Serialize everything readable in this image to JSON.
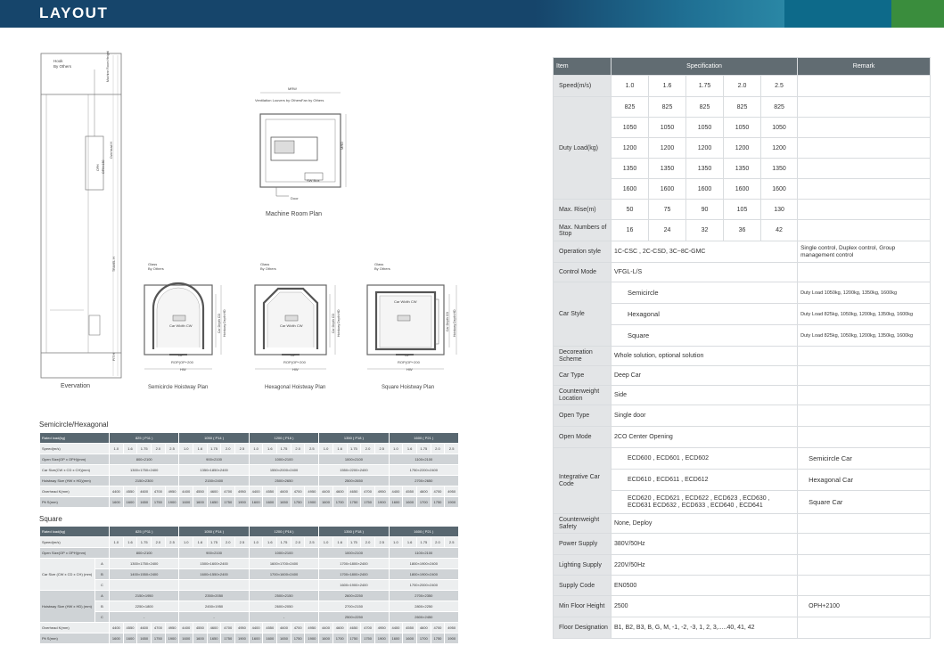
{
  "header": {
    "title": "LAYOUT"
  },
  "drawings": {
    "elevation": {
      "caption": "Evervation",
      "hook": "Hook",
      "by_others": "By Others",
      "machine_room_height": "Machine Room Height",
      "overhead": "Overhead H",
      "oph": "OPH",
      "oph_value": "OPH=150",
      "travel": "TRAVEL H",
      "pit": "PIT H"
    },
    "machine_room": {
      "caption": "Machine Room Plan",
      "mrw": "MRW",
      "mrd": "MRD",
      "ventilation": "Ventilation Louvers by Others",
      "fan": "Fan by Others",
      "sw_box": "SW Box",
      "door": "Door"
    },
    "plans": [
      {
        "caption": "Semicircle Hoistway Plan",
        "glass": "Glass",
        "by_others": "By Others",
        "car_width": "Car Width CW",
        "car_depth": "Car Depth CD",
        "hoistway_depth": "Hoistway Depth HD",
        "op": "OP",
        "rop": "ROP(OP+200",
        "hw": "HW"
      },
      {
        "caption": "Hexagonal Hoistway Plan",
        "glass": "Glass",
        "by_others": "By Others",
        "car_width": "Car Width CW",
        "car_depth": "Car Depth CD",
        "hoistway_depth": "Hoistway Depth HD",
        "op": "OP",
        "rop": "ROP(OP+200",
        "hw": "HW"
      },
      {
        "caption": "Square Hoistway Plan",
        "glass": "Glass",
        "by_others": "By Others",
        "car_width": "Car Width CW",
        "car_depth": "Car Depth CD",
        "hoistway_depth": "Hoistway Depth HD",
        "op": "OP",
        "rop": "ROP(OP+200",
        "hw": "HW"
      }
    ]
  },
  "table1": {
    "title": "Semicircle/Hexagonal",
    "rows": [
      {
        "label": "Rated load(kg)",
        "cells": [
          {
            "t": "825 ( P11 )",
            "span": 5
          },
          {
            "t": "1050 ( P14 )",
            "span": 5
          },
          {
            "t": "1200 ( P16 )",
            "span": 5
          },
          {
            "t": "1350 ( P18 )",
            "span": 5
          },
          {
            "t": "1600 ( P21 )",
            "span": 5
          }
        ],
        "cls": "hd"
      },
      {
        "label": "Speed(m/s)",
        "cells": [
          {
            "t": "1.0"
          },
          {
            "t": "1.6"
          },
          {
            "t": "1.75"
          },
          {
            "t": "2.0"
          },
          {
            "t": "2.5"
          },
          {
            "t": "1.0"
          },
          {
            "t": "1.6"
          },
          {
            "t": "1.75"
          },
          {
            "t": "2.0"
          },
          {
            "t": "2.5"
          },
          {
            "t": "1.0"
          },
          {
            "t": "1.6"
          },
          {
            "t": "1.75"
          },
          {
            "t": "2.0"
          },
          {
            "t": "2.5"
          },
          {
            "t": "1.0"
          },
          {
            "t": "1.6"
          },
          {
            "t": "1.75"
          },
          {
            "t": "2.0"
          },
          {
            "t": "2.5"
          },
          {
            "t": "1.0"
          },
          {
            "t": "1.6"
          },
          {
            "t": "1.75"
          },
          {
            "t": "2.0"
          },
          {
            "t": "2.5"
          }
        ],
        "cls": "lt"
      },
      {
        "label": "Open Size(OP x OPH)(mm)",
        "cells": [
          {
            "t": "800×2100",
            "span": 5
          },
          {
            "t": "900×2100",
            "span": 5
          },
          {
            "t": "1000×2100",
            "span": 5
          },
          {
            "t": "1000×2100",
            "span": 5
          },
          {
            "t": "1100×2100",
            "span": 5
          }
        ],
        "cls": "dk"
      },
      {
        "label": "Car Size(CW x CD x CH)(mm)",
        "cells": [
          {
            "t": "1300×1750×2400",
            "span": 5
          },
          {
            "t": "1350×1850×2400",
            "span": 5
          },
          {
            "t": "1550×2000×2400",
            "span": 5
          },
          {
            "t": "1550×2200×2400",
            "span": 5
          },
          {
            "t": "1750×2200×2400",
            "span": 5
          }
        ],
        "cls": "lt"
      },
      {
        "label": "Hoistway Size (HW x HD)(mm)",
        "cells": [
          {
            "t": "2150×2300",
            "span": 5
          },
          {
            "t": "2150×2400",
            "span": 5
          },
          {
            "t": "2500×2650",
            "span": 5
          },
          {
            "t": "2500×2650",
            "span": 5
          },
          {
            "t": "2700×2650",
            "span": 5
          }
        ],
        "cls": "dk"
      },
      {
        "label": "Overhead K(mm)",
        "cells": [
          {
            "t": "4400"
          },
          {
            "t": "4550"
          },
          {
            "t": "4600"
          },
          {
            "t": "4700"
          },
          {
            "t": "4950"
          },
          {
            "t": "4400"
          },
          {
            "t": "4550"
          },
          {
            "t": "4600"
          },
          {
            "t": "4700"
          },
          {
            "t": "4950"
          },
          {
            "t": "4400"
          },
          {
            "t": "4550"
          },
          {
            "t": "4600"
          },
          {
            "t": "4700"
          },
          {
            "t": "4950"
          },
          {
            "t": "4400"
          },
          {
            "t": "4600"
          },
          {
            "t": "4650"
          },
          {
            "t": "4700"
          },
          {
            "t": "4950"
          },
          {
            "t": "4400"
          },
          {
            "t": "4550"
          },
          {
            "t": "4600"
          },
          {
            "t": "4700"
          },
          {
            "t": "4950"
          }
        ],
        "cls": "lt"
      },
      {
        "label": "Pit S(mm)",
        "cells": [
          {
            "t": "1600"
          },
          {
            "t": "1600"
          },
          {
            "t": "1650"
          },
          {
            "t": "1750"
          },
          {
            "t": "1900"
          },
          {
            "t": "1600"
          },
          {
            "t": "1600"
          },
          {
            "t": "1650"
          },
          {
            "t": "1750"
          },
          {
            "t": "1900"
          },
          {
            "t": "1600"
          },
          {
            "t": "1600"
          },
          {
            "t": "1650"
          },
          {
            "t": "1750"
          },
          {
            "t": "1900"
          },
          {
            "t": "1600"
          },
          {
            "t": "1700"
          },
          {
            "t": "1750"
          },
          {
            "t": "1750"
          },
          {
            "t": "1900"
          },
          {
            "t": "1600"
          },
          {
            "t": "1600"
          },
          {
            "t": "1700"
          },
          {
            "t": "1750"
          },
          {
            "t": "1900"
          }
        ],
        "cls": "dk"
      }
    ]
  },
  "table2": {
    "title": "Square",
    "rows": [
      {
        "label": "Rated load(kg)",
        "sub": null,
        "cells": [
          {
            "t": "825 ( P11 )",
            "span": 5
          },
          {
            "t": "1050 ( P14 )",
            "span": 5
          },
          {
            "t": "1200 ( P16 )",
            "span": 5
          },
          {
            "t": "1350 ( P18 )",
            "span": 5
          },
          {
            "t": "1600 ( P21 )",
            "span": 5
          }
        ],
        "cls": "hd"
      },
      {
        "label": "Speed(m/s)",
        "cells": [
          {
            "t": "1.0"
          },
          {
            "t": "1.6"
          },
          {
            "t": "1.75"
          },
          {
            "t": "2.0"
          },
          {
            "t": "2.5"
          },
          {
            "t": "1.0"
          },
          {
            "t": "1.6"
          },
          {
            "t": "1.75"
          },
          {
            "t": "2.0"
          },
          {
            "t": "2.5"
          },
          {
            "t": "1.0"
          },
          {
            "t": "1.6"
          },
          {
            "t": "1.75"
          },
          {
            "t": "2.0"
          },
          {
            "t": "2.5"
          },
          {
            "t": "1.0"
          },
          {
            "t": "1.6"
          },
          {
            "t": "1.75"
          },
          {
            "t": "2.0"
          },
          {
            "t": "2.5"
          },
          {
            "t": "1.0"
          },
          {
            "t": "1.6"
          },
          {
            "t": "1.75"
          },
          {
            "t": "2.0"
          },
          {
            "t": "2.5"
          }
        ],
        "cls": "lt"
      },
      {
        "label": "Open Size(OP x OPH)(mm)",
        "cells": [
          {
            "t": "800×2100",
            "span": 5
          },
          {
            "t": "900×2100",
            "span": 5
          },
          {
            "t": "1000×2100",
            "span": 5
          },
          {
            "t": "1000×2100",
            "span": 5
          },
          {
            "t": "1100×2100",
            "span": 5
          }
        ],
        "cls": "dk"
      }
    ],
    "car_size_label": "Car Size (CW x CD x CH) (mm)",
    "car_size": [
      {
        "sub": "A",
        "cells": [
          "1300×1750×2400",
          "1500×1600×2400",
          "1600×1700×2400",
          "1700×1800×2400",
          "1800×1900×2400"
        ],
        "cls": "lt"
      },
      {
        "sub": "B",
        "cells": [
          "1400×1550×2400",
          "1600×1550×2400",
          "1700×1600×2400",
          "1700×1800×2400",
          "1800×1900×2400"
        ],
        "cls": "dk"
      },
      {
        "sub": "C",
        "cells": [
          "",
          "",
          "",
          "1600×1900×2400",
          "1700×2000×2400"
        ],
        "cls": "lt"
      }
    ],
    "hoistway_label": "Hoistway Size (HW x HD) (mm)",
    "hoistway": [
      {
        "sub": "A",
        "cells": [
          "2150×1950",
          "2350×2050",
          "2500×2150",
          "2600×2250",
          "2700×2350"
        ],
        "cls": "dk"
      },
      {
        "sub": "B",
        "cells": [
          "2250×1800",
          "2450×1950",
          "2600×2050",
          "2700×2150",
          "2800×2250"
        ],
        "cls": "lt"
      },
      {
        "sub": "C",
        "cells": [
          "-",
          "-",
          "-",
          "2500×2250",
          "2600×2450"
        ],
        "cls": "dk"
      }
    ],
    "tail": [
      {
        "label": "Overhead K(mm)",
        "cells": [
          "4400",
          "4550",
          "4600",
          "4700",
          "4950",
          "4400",
          "4550",
          "4600",
          "4700",
          "4950",
          "4400",
          "4550",
          "4600",
          "4700",
          "4950",
          "4400",
          "4600",
          "4650",
          "4700",
          "4950",
          "4400",
          "4550",
          "4600",
          "4700",
          "4950"
        ],
        "cls": "lt"
      },
      {
        "label": "Pit S(mm)",
        "cells": [
          "1600",
          "1600",
          "1650",
          "1750",
          "1900",
          "1600",
          "1600",
          "1650",
          "1750",
          "1900",
          "1600",
          "1600",
          "1650",
          "1750",
          "1900",
          "1600",
          "1700",
          "1750",
          "1750",
          "1900",
          "1600",
          "1600",
          "1700",
          "1750",
          "1900"
        ],
        "cls": "dk"
      }
    ]
  },
  "spec": {
    "head": {
      "item": "Item",
      "specification": "Specification",
      "remark": "Remark"
    },
    "speed_label": "Speed(m/s)",
    "speeds": [
      "1.0",
      "1.6",
      "1.75",
      "2.0",
      "2.5"
    ],
    "duty_label": "Duty Load(kg)",
    "duty_rows": [
      [
        "825",
        "825",
        "825",
        "825",
        "825"
      ],
      [
        "1050",
        "1050",
        "1050",
        "1050",
        "1050"
      ],
      [
        "1200",
        "1200",
        "1200",
        "1200",
        "1200"
      ],
      [
        "1350",
        "1350",
        "1350",
        "1350",
        "1350"
      ],
      [
        "1600",
        "1600",
        "1600",
        "1600",
        "1600"
      ]
    ],
    "rise_label": "Max. Rise(m)",
    "rises": [
      "50",
      "75",
      "90",
      "105",
      "130"
    ],
    "stops_label": "Max. Numbers of Stop",
    "stops": [
      "16",
      "24",
      "32",
      "36",
      "42"
    ],
    "operation": {
      "label": "Operation style",
      "value": "1C-CSC , 2C-CSD, 3C~8C-GMC",
      "remark": "Single control, Duplex control, Group management control"
    },
    "control": {
      "label": "Control Mode",
      "value": "VFGL-L/S"
    },
    "car_style": {
      "label": "Car Style",
      "rows": [
        {
          "value": "Semicircle",
          "remark": "Duty Load 1050kg, 1200kg, 1350kg, 1600kg"
        },
        {
          "value": "Hexagonal",
          "remark": "Duty Load 825kg, 1050kg, 1200kg, 1350kg, 1600kg"
        },
        {
          "value": "Square",
          "remark": "Duty Load 825kg, 1050kg, 1200kg, 1350kg, 1600kg"
        }
      ]
    },
    "decoration": {
      "label": "Decoreation Scheme",
      "value": "Whole solution, optional solution"
    },
    "car_type": {
      "label": "Car Type",
      "value": "Deep Car"
    },
    "cw_location": {
      "label": "Counterweight Location",
      "value": "Side"
    },
    "open_type": {
      "label": "Open Type",
      "value": "Single door"
    },
    "open_mode": {
      "label": "Open Mode",
      "value": "2CO Center Opening"
    },
    "integrative": {
      "label": "Integrative Car Code",
      "rows": [
        {
          "value": "ECD600 , ECD601 , ECD602",
          "remark": "Semicircle Car"
        },
        {
          "value": "ECD610 , ECD611 , ECD612",
          "remark": "Hexagonal Car"
        },
        {
          "value": "ECD620 , ECD621 , ECD622 , ECD623 , ECD630 , ECD631 ECD632 , ECD633 , ECD640 , ECD641",
          "remark": "Square Car"
        }
      ]
    },
    "cw_safety": {
      "label": "Counterweight Safety",
      "value": "None, Deploy"
    },
    "power": {
      "label": "Power Supply",
      "value": "380V/50Hz"
    },
    "lighting": {
      "label": "Lighting Supply",
      "value": "220V/50Hz"
    },
    "supply_code": {
      "label": "Supply Code",
      "value": "EN0500"
    },
    "min_floor": {
      "label": "Min Floor Height",
      "value": "2500",
      "remark": "OPH+2100"
    },
    "floor_designation": {
      "label": "Floor Designation",
      "value": "B1, B2, B3, B, G, M, -1, -2, -3, 1, 2, 3,.....40, 41, 42"
    }
  }
}
